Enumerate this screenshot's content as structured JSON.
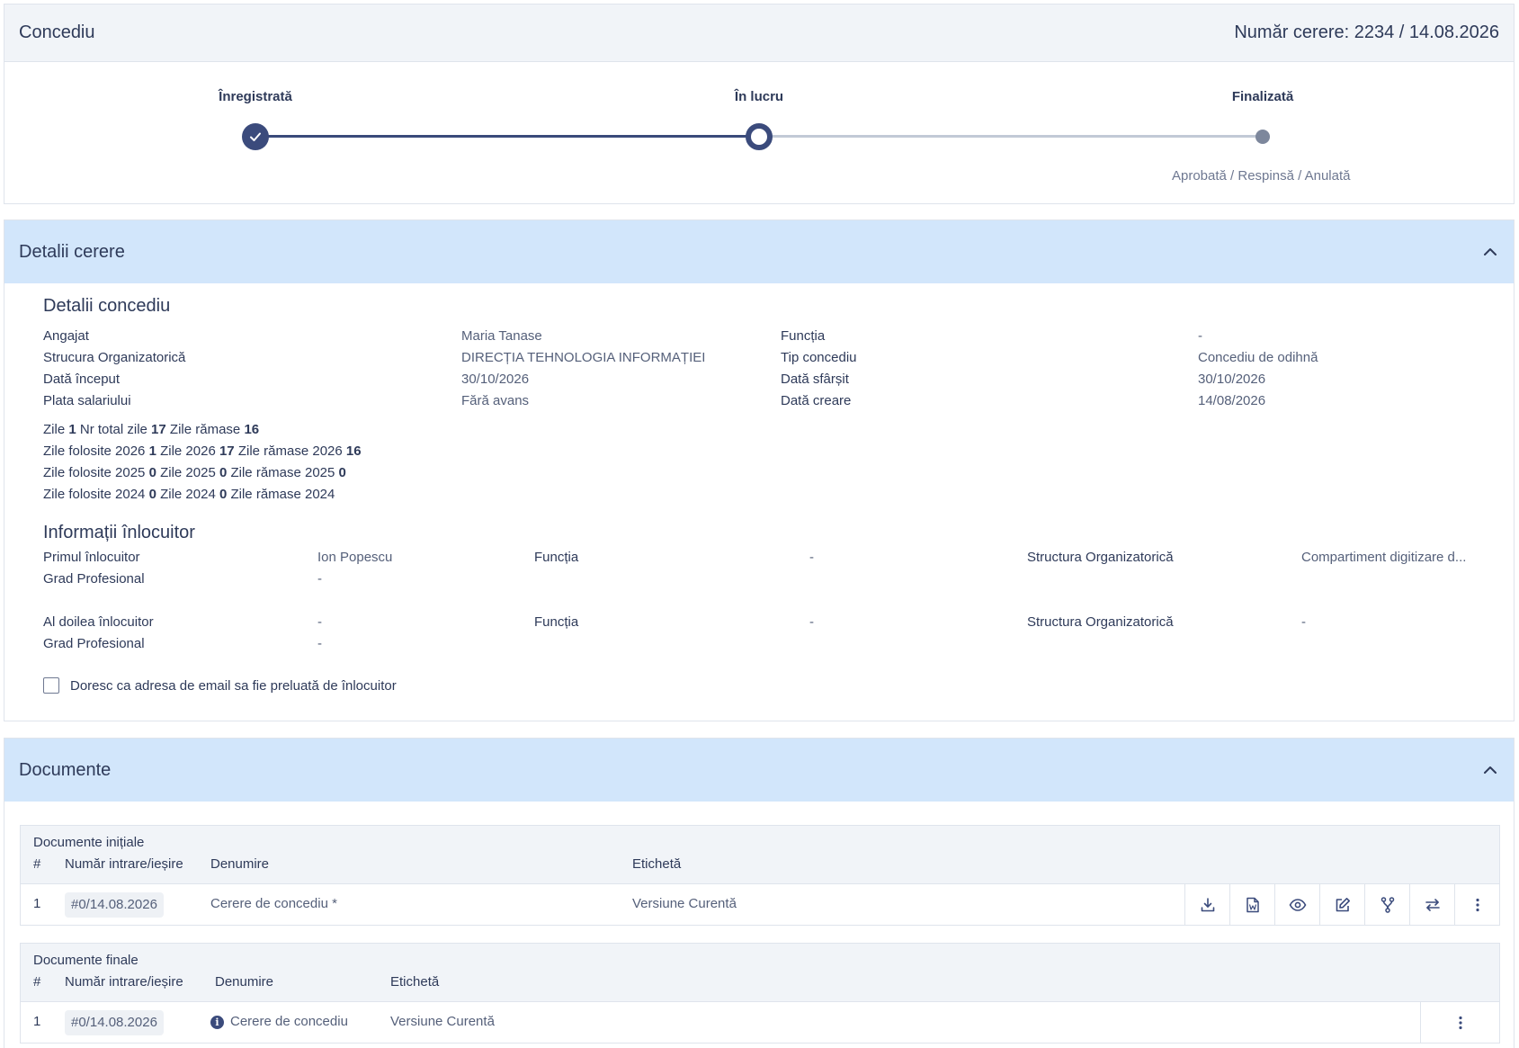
{
  "header": {
    "title": "Concediu",
    "request_number": "Număr cerere: 2234 / 14.08.2026"
  },
  "progress": {
    "steps": [
      {
        "label": "Înregistrată",
        "state": "done"
      },
      {
        "label": "În lucru",
        "state": "current"
      },
      {
        "label": "Finalizată",
        "state": "pending"
      }
    ],
    "final_subtitle": "Aprobată / Respinsă / Anulată"
  },
  "details": {
    "panel_title": "Detalii cerere",
    "leave_title": "Detalii concediu",
    "fields": [
      {
        "label": "Angajat",
        "value": "Maria Tanase"
      },
      {
        "label": "Strucura Organizatorică",
        "value": "DIRECȚIA TEHNOLOGIA INFORMAȚIEI"
      },
      {
        "label": "Dată început",
        "value": "30/10/2026"
      },
      {
        "label": "Plata salariului",
        "value": "Fără avans"
      },
      {
        "label": "Funcția",
        "value": "-"
      },
      {
        "label": "Tip concediu",
        "value": "Concediu de odihnă"
      },
      {
        "label": "Dată sfârșit",
        "value": "30/10/2026"
      },
      {
        "label": "Dată creare",
        "value": "14/08/2026"
      }
    ],
    "days": {
      "l1": [
        "Zile ",
        "1",
        " Nr total zile ",
        "17",
        " Zile rămase ",
        "16"
      ],
      "l2": [
        "Zile folosite 2026 ",
        "1",
        " Zile 2026 ",
        "17",
        " Zile rămase 2026 ",
        "16"
      ],
      "l3": [
        "Zile folosite 2025 ",
        "0",
        " Zile 2025 ",
        "0",
        " Zile rămase 2025 ",
        "0"
      ],
      "l4": [
        "Zile folosite 2024 ",
        "0",
        " Zile 2024 ",
        "0",
        " Zile rămase 2024",
        ""
      ]
    },
    "replacement_title": "Informații înlocuitor",
    "replacement1": {
      "label": "Primul înlocuitor",
      "name": "Ion Popescu",
      "function_label": "Funcția",
      "function_value": "-",
      "struct_label": "Structura Organizatorică",
      "struct_value": "Compartiment digitizare d...",
      "grade_label": "Grad Profesional",
      "grade_value": "-"
    },
    "replacement2": {
      "label": "Al doilea înlocuitor",
      "name": "-",
      "function_label": "Funcția",
      "function_value": "-",
      "struct_label": "Structura Organizatorică",
      "struct_value": "-",
      "grade_label": "Grad Profesional",
      "grade_value": "-"
    },
    "email_checkbox_label": "Doresc ca adresa de email sa fie preluată de înlocuitor"
  },
  "documents": {
    "panel_title": "Documente",
    "initial": {
      "title": "Documente inițiale",
      "headers": [
        "#",
        "Număr intrare/ieșire",
        "Denumire",
        "Etichetă"
      ],
      "row": {
        "index": "1",
        "number": "#0/14.08.2026",
        "name": "Cerere de concediu *",
        "tag": "Versiune Curentă"
      },
      "actions": [
        "download-icon",
        "word-file-icon",
        "eye-icon",
        "edit-icon",
        "branch-icon",
        "swap-icon",
        "more-vertical-icon"
      ]
    },
    "final": {
      "title": "Documente finale",
      "headers": [
        "#",
        "Număr intrare/ieșire",
        "Denumire",
        "Etichetă"
      ],
      "row": {
        "index": "1",
        "number": "#0/14.08.2026",
        "name": "Cerere de concediu",
        "tag": "Versiune Curentă"
      },
      "actions": [
        "more-vertical-icon"
      ]
    }
  },
  "colors": {
    "primary": "#3b4b7c",
    "accent_bar": "#d2e6fb",
    "header_bg": "#f1f4f8"
  }
}
